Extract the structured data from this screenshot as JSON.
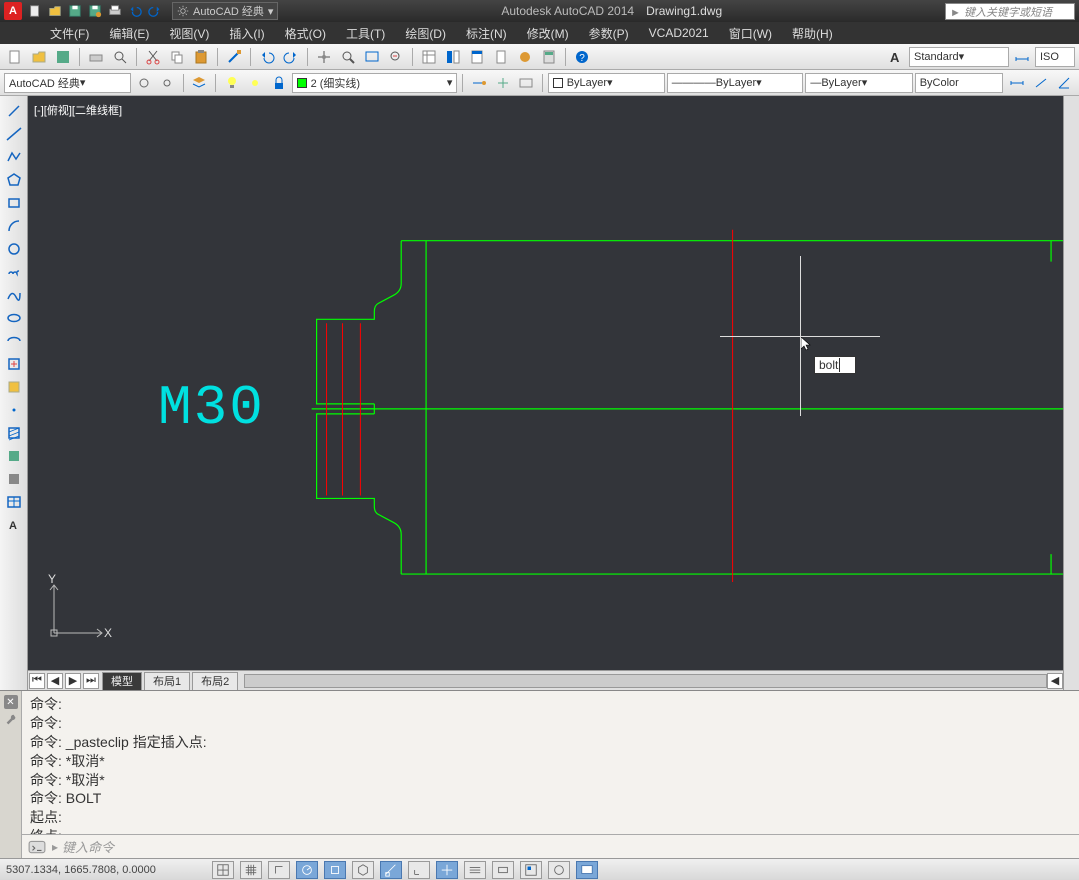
{
  "app": {
    "title": "Autodesk AutoCAD 2014",
    "filename": "Drawing1.dwg",
    "search_placeholder": "键入关键字或短语"
  },
  "workspace": {
    "label": "AutoCAD 经典"
  },
  "menu": [
    "文件(F)",
    "编辑(E)",
    "视图(V)",
    "插入(I)",
    "格式(O)",
    "工具(T)",
    "绘图(D)",
    "标注(N)",
    "修改(M)",
    "参数(P)",
    "VCAD2021",
    "窗口(W)",
    "帮助(H)"
  ],
  "toolbar2": {
    "workspace_dd": "AutoCAD 经典",
    "layer_dd": "2 (细实线)",
    "linetype_dd": "ByLayer",
    "lineweight_dd": "ByLayer",
    "color_dd": "ByColor",
    "style_dd": "Standard",
    "iso_dd": "ISO"
  },
  "viewport": {
    "label": "[-][俯视][二维线框]"
  },
  "drawing": {
    "annotation": "M30",
    "input_value": "bolt"
  },
  "tabs": {
    "model": "模型",
    "layout1": "布局1",
    "layout2": "布局2"
  },
  "command_log": [
    "命令:",
    "命令:",
    "命令: _pasteclip 指定插入点:",
    "命令: *取消*",
    "命令: *取消*",
    "命令: BOLT",
    "起点:",
    "终点:"
  ],
  "command_input_placeholder": "键入命令",
  "status": {
    "coords": "5307.1334, 1665.7808, 0.0000"
  },
  "ucs": {
    "x": "X",
    "y": "Y"
  }
}
